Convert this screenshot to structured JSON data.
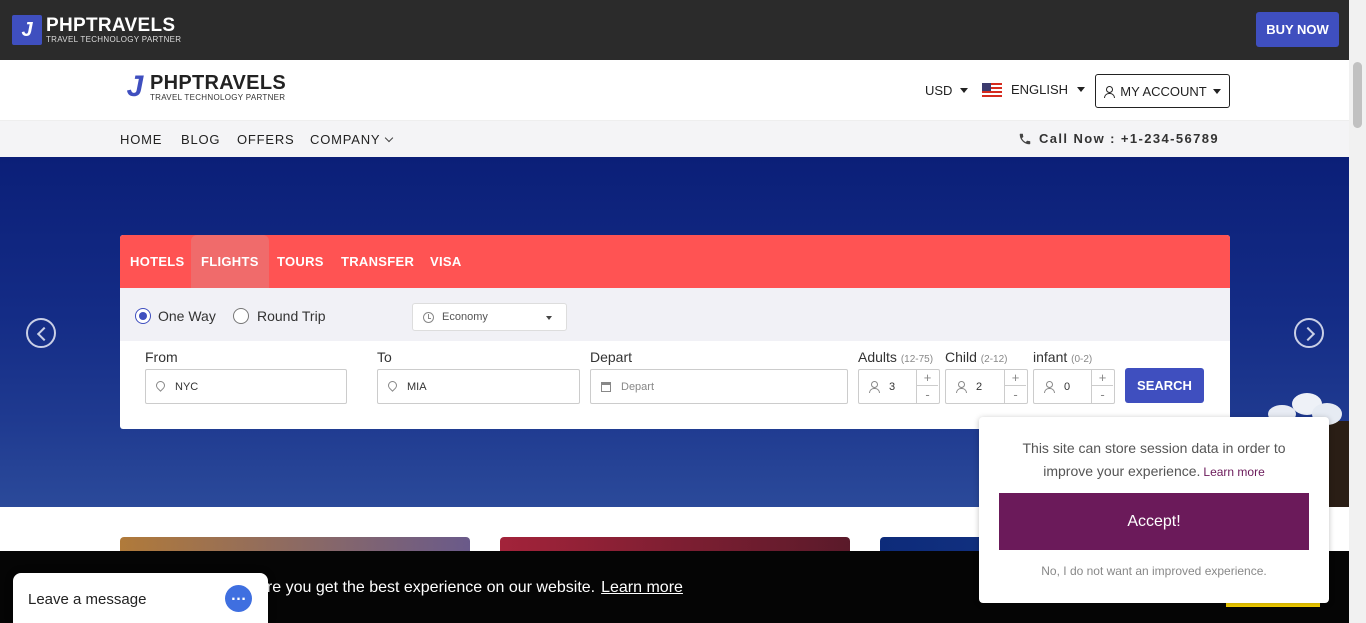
{
  "topbar": {
    "brand": "PHPTRAVELS",
    "tagline": "TRAVEL TECHNOLOGY PARTNER",
    "buy_now": "BUY NOW"
  },
  "header": {
    "brand": "PHPTRAVELS",
    "tagline": "TRAVEL TECHNOLOGY PARTNER",
    "currency": "USD",
    "language": "ENGLISH",
    "account": "MY ACCOUNT"
  },
  "nav": {
    "items": [
      "HOME",
      "BLOG",
      "OFFERS",
      "COMPANY"
    ],
    "call": "Call Now : +1-234-56789"
  },
  "search": {
    "tabs": [
      "HOTELS",
      "FLIGHTS",
      "TOURS",
      "TRANSFER",
      "VISA"
    ],
    "active_tab": "FLIGHTS",
    "one_way": "One Way",
    "round_trip": "Round Trip",
    "cabin_class": "Economy",
    "from_label": "From",
    "from_value": "NYC",
    "to_label": "To",
    "to_value": "MIA",
    "depart_label": "Depart",
    "depart_placeholder": "Depart",
    "adults_label": "Adults",
    "adults_range": "(12-75)",
    "adults_value": "3",
    "child_label": "Child",
    "child_range": "(2-12)",
    "child_value": "2",
    "infant_label": "infant",
    "infant_range": "(0-2)",
    "infant_value": "0",
    "plus": "+",
    "minus": "-",
    "search_button": "SEARCH"
  },
  "cookie_bar": {
    "text": "ure you get the best experience on our website.",
    "learn_more": "Learn more"
  },
  "consent": {
    "text": "This site can store session data in order to improve your experience.",
    "learn_more": "Learn more",
    "accept": "Accept!",
    "decline": "No, I do not want an improved experience."
  },
  "chat": {
    "label": "Leave a message"
  },
  "colors": {
    "brand_blue": "#3f4fbf",
    "tab_red": "#ff5353",
    "consent_purple": "#6b1a5a",
    "topbar_dark": "#2b2b2b"
  }
}
